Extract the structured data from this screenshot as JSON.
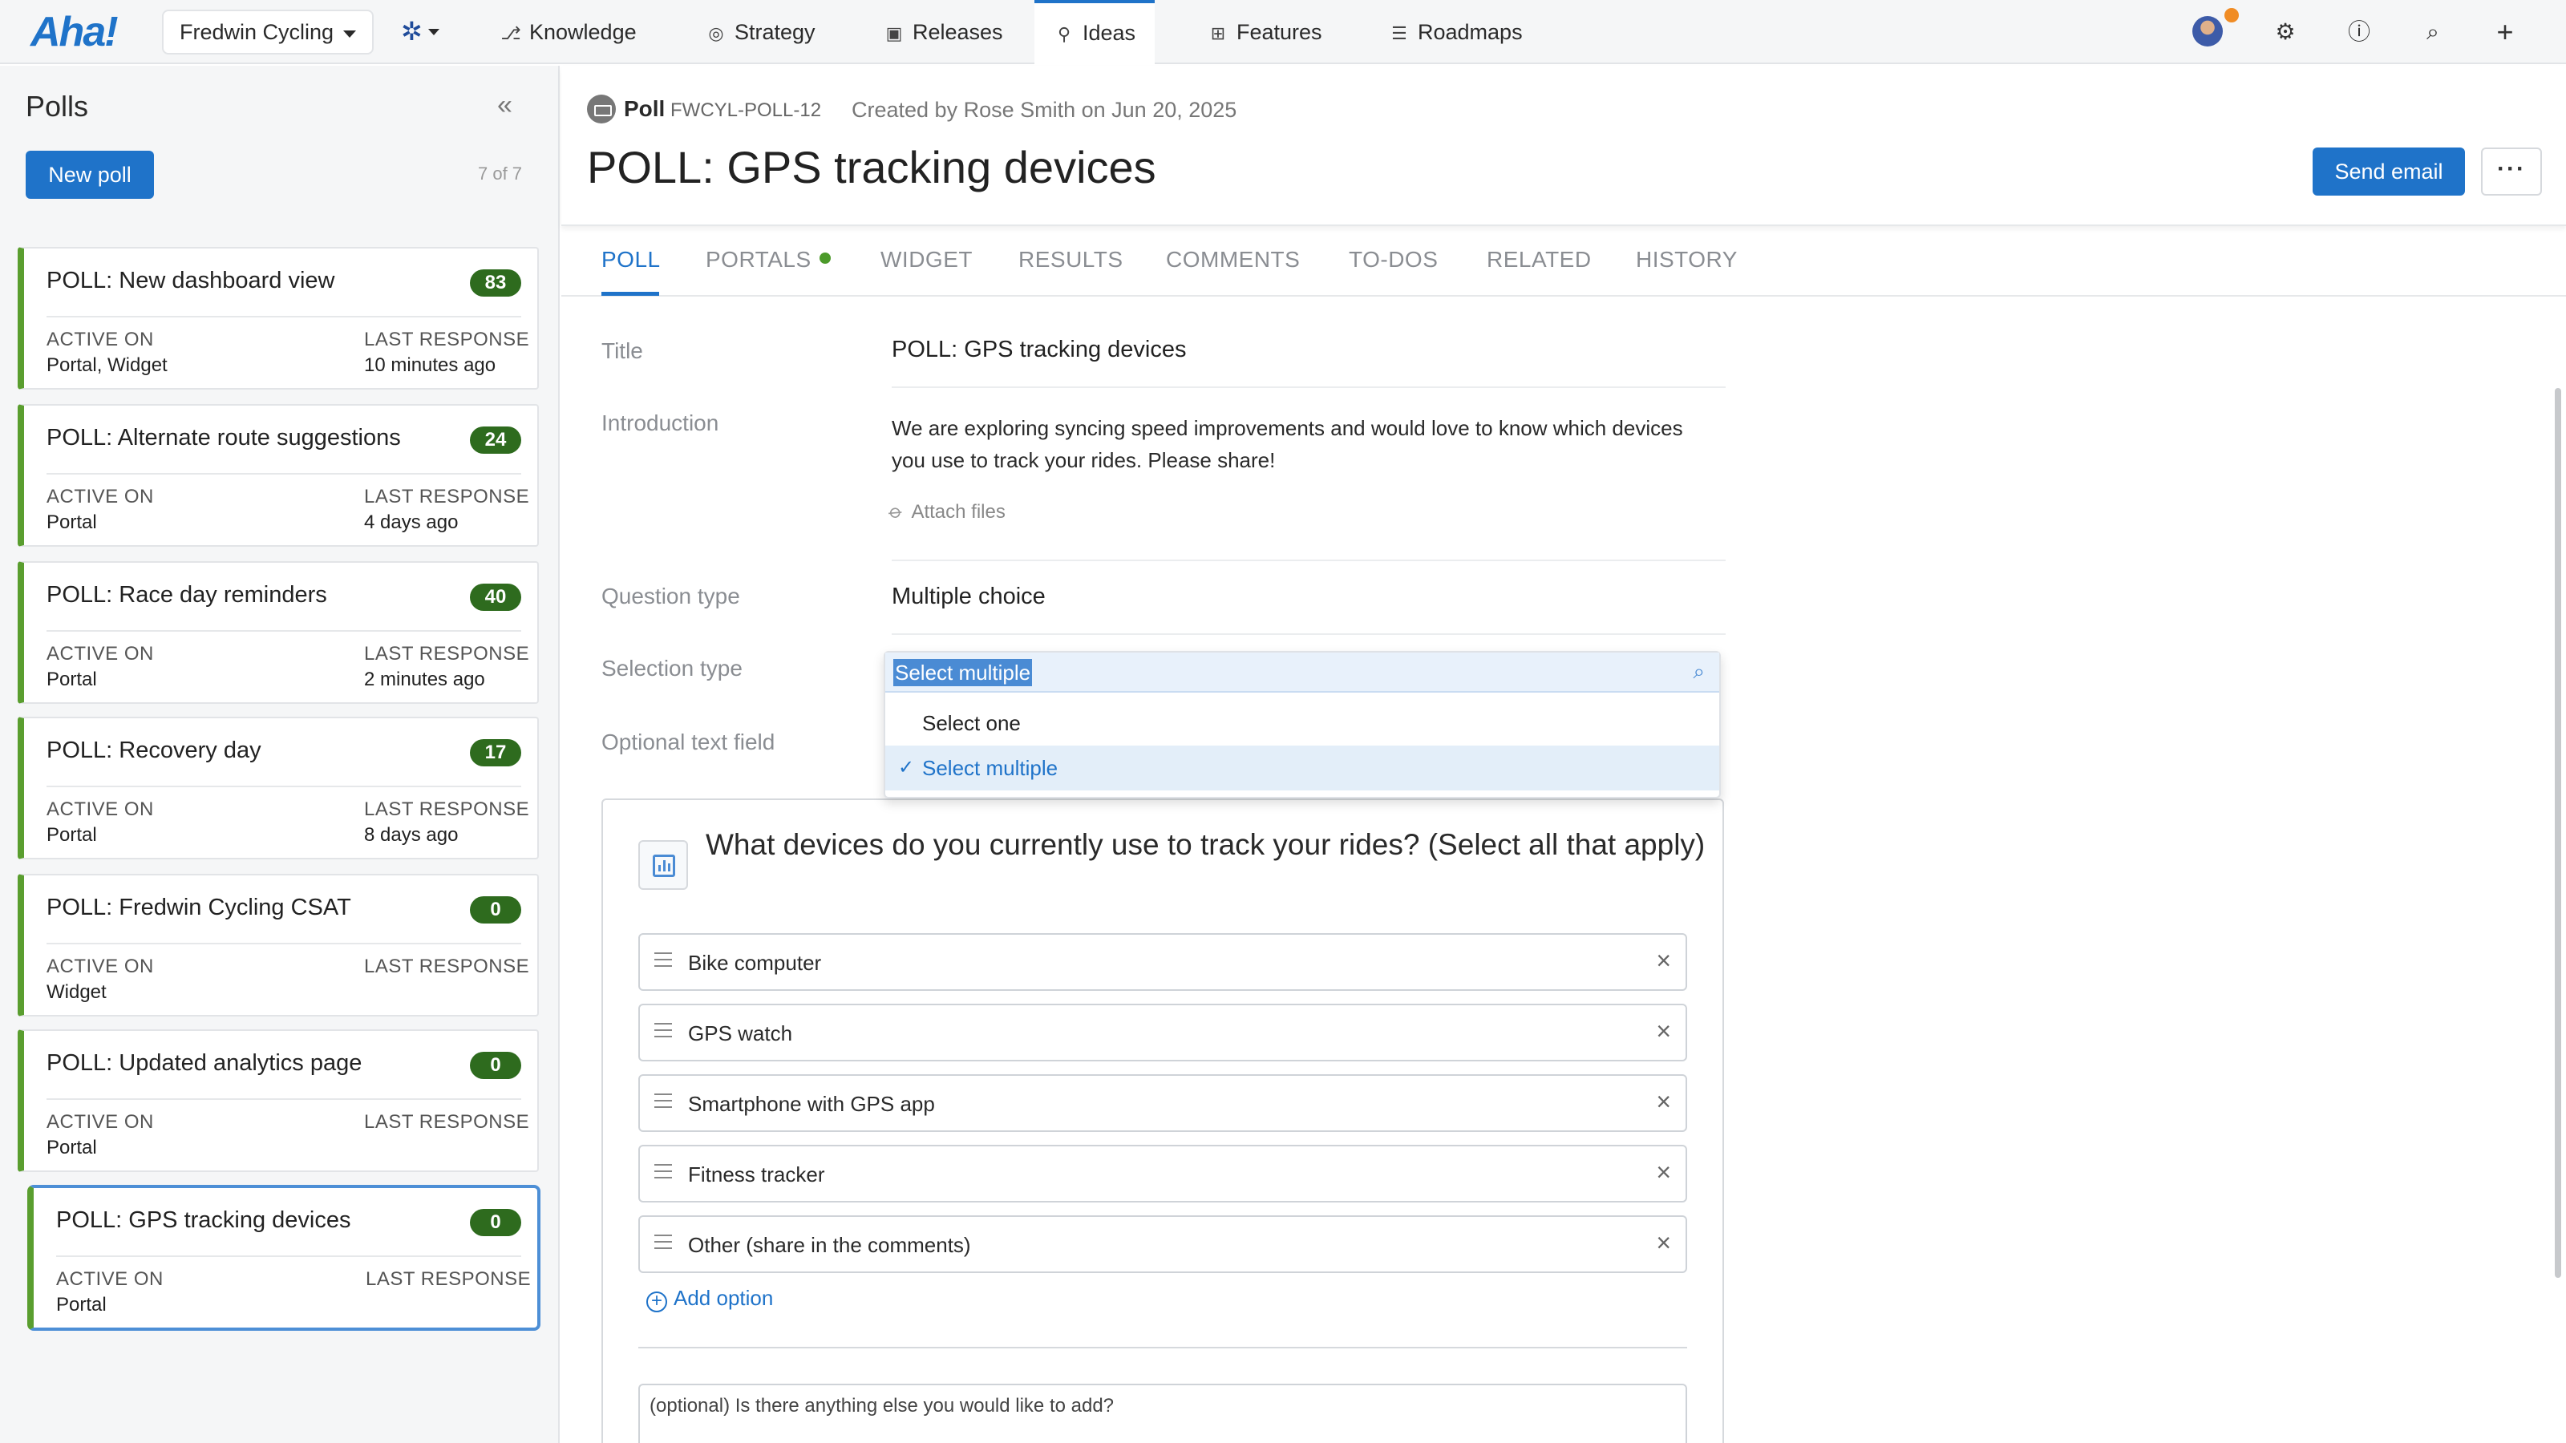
{
  "app": {
    "logo": "Aha!"
  },
  "topnav": {
    "workspace": "Fredwin Cycling",
    "items": [
      {
        "label": "Knowledge",
        "icon": "knowledge-icon",
        "glyph": "⎇"
      },
      {
        "label": "Strategy",
        "icon": "strategy-icon",
        "glyph": "◎"
      },
      {
        "label": "Releases",
        "icon": "releases-icon",
        "glyph": "▣"
      },
      {
        "label": "Ideas",
        "icon": "lightbulb-icon",
        "glyph": "⚲"
      },
      {
        "label": "Features",
        "icon": "features-icon",
        "glyph": "⊞"
      },
      {
        "label": "Roadmaps",
        "icon": "roadmaps-icon",
        "glyph": "☰"
      }
    ],
    "active": "Ideas"
  },
  "sidebar": {
    "title": "Polls",
    "new_poll": "New poll",
    "count": "7 of 7",
    "active_label": "ACTIVE ON",
    "last_label": "LAST RESPONSE",
    "polls": [
      {
        "title": "POLL: New dashboard view",
        "count": "83",
        "active_on": "Portal, Widget",
        "last_response": "10 minutes ago"
      },
      {
        "title": "POLL: Alternate route suggestions",
        "count": "24",
        "active_on": "Portal",
        "last_response": "4 days ago"
      },
      {
        "title": "POLL: Race day reminders",
        "count": "40",
        "active_on": "Portal",
        "last_response": "2 minutes ago"
      },
      {
        "title": "POLL: Recovery day",
        "count": "17",
        "active_on": "Portal",
        "last_response": "8 days ago"
      },
      {
        "title": "POLL: Fredwin Cycling CSAT",
        "count": "0",
        "active_on": "Widget",
        "last_response": ""
      },
      {
        "title": "POLL: Updated analytics page",
        "count": "0",
        "active_on": "Portal",
        "last_response": ""
      },
      {
        "title": "POLL: GPS tracking devices",
        "count": "0",
        "active_on": "Portal",
        "last_response": ""
      }
    ]
  },
  "record": {
    "type": "Poll",
    "id": "FWCYL-POLL-12",
    "created": "Created by Rose Smith on Jun 20, 2025",
    "title": "POLL: GPS tracking devices",
    "send_email": "Send email",
    "more": "···"
  },
  "tabs": [
    "POLL",
    "PORTALS",
    "WIDGET",
    "RESULTS",
    "COMMENTS",
    "TO-DOS",
    "RELATED",
    "HISTORY"
  ],
  "form": {
    "title_label": "Title",
    "title_value": "POLL: GPS tracking devices",
    "intro_label": "Introduction",
    "intro_value": "We are exploring syncing speed improvements and would love to know which devices you use to track your rides. Please share!",
    "attach": "Attach files",
    "qtype_label": "Question type",
    "qtype_value": "Multiple choice",
    "seltype_label": "Selection type",
    "optional_label": "Optional text field"
  },
  "dropdown": {
    "current": "Select multiple",
    "options": [
      "Select one",
      "Select multiple"
    ],
    "selected": "Select multiple"
  },
  "poll": {
    "question": "What devices do you currently use to track your rides? (Select all that apply)",
    "options": [
      "Bike computer",
      "GPS watch",
      "Smartphone with GPS app",
      "Fitness tracker",
      "Other (share in the comments)"
    ],
    "add_option": "Add option",
    "optional_prompt": "(optional) Is there anything else you would like to add?"
  },
  "colors": {
    "accent": "#1f73c9",
    "badge": "#2e6b1e",
    "card_border": "#5a9e2f",
    "notif": "#f08c24"
  }
}
